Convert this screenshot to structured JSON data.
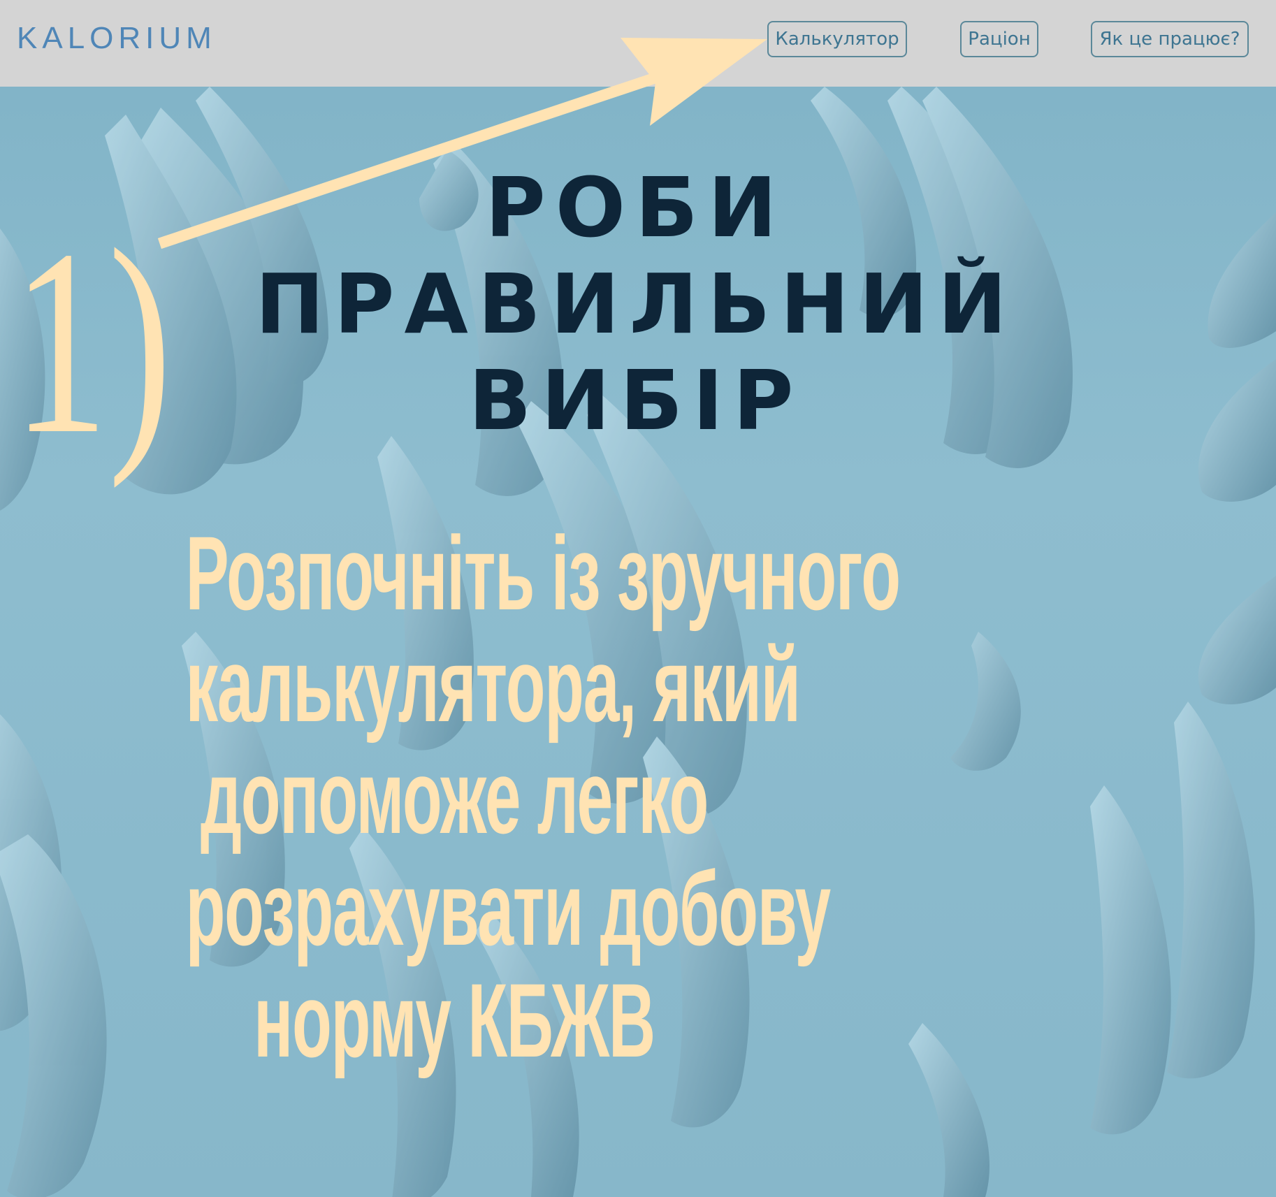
{
  "header": {
    "logo": "KALORIUM",
    "nav": [
      {
        "label": "Калькулятор"
      },
      {
        "label": "Раціон"
      },
      {
        "label": "Як це працює?"
      }
    ]
  },
  "hero": {
    "title_lines": [
      "РОБИ",
      "ПРАВИЛЬНИЙ",
      "ВИБІР"
    ],
    "subtitle_lines": [
      "Розпочніть із зручного",
      "калькулятора, який",
      "допоможе легко",
      "розрахувати добову",
      "норму КБЖВ"
    ]
  },
  "annotation": {
    "step_label": "1)",
    "arrow_target": "Калькулятор"
  },
  "colors": {
    "header_bg": "#d4d4d4",
    "logo": "#4f86b7",
    "nav_text": "#3e7591",
    "background": "#8ebdcf",
    "title": "#0e2538",
    "highlight": "#ffe3b3"
  }
}
